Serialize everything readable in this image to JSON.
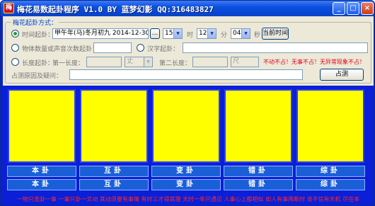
{
  "window": {
    "title": "梅花易数起卦程序 V1.0  BY 蓝梦幻影 QQ:316483827",
    "icon_char": "梅"
  },
  "titlebar_buttons": {
    "minimize": "_",
    "maximize": "□",
    "close": "×"
  },
  "group": {
    "title": "梅花起卦方式："
  },
  "time": {
    "label": "时间起卦：",
    "date_value": "甲午年(马)冬月初九 2014-12-30",
    "browse_label": "...",
    "hour_value": "15",
    "hour_unit": "时",
    "minute_value": "12",
    "minute_unit": "分",
    "second_value": "04",
    "second_unit": "秒",
    "now_button": "当前时间"
  },
  "quantity": {
    "label": "物体数量或声音次数起卦：",
    "value": "",
    "hanzi_label": "汉字起卦：",
    "hanzi_value": ""
  },
  "length": {
    "label": "长度起卦：",
    "first_label": "第一长度：",
    "first_value": "",
    "first_unit": "丈",
    "second_label": "第二长度：",
    "second_value": "",
    "second_unit": "尺",
    "note": "不动不占！无事不占！无异常现象不占！"
  },
  "question": {
    "label": "占测原因及疑问：",
    "value": "",
    "divine_button": "占测"
  },
  "hexagrams": {
    "labels": [
      "本卦",
      "互卦",
      "变卦",
      "错卦",
      "综卦"
    ],
    "labels_row2": [
      "本卦",
      "互卦",
      "变卦",
      "错卦",
      "综卦"
    ]
  },
  "footer": {
    "text": "一物只准卦一事  一事只卦一爻动  其动须要有事情  有时三才得其理  天时一年只遇见  人事心上都相似  如人有事再断时  谁不信有天机 尽在本"
  },
  "colors": {
    "window_bg": "#0a1fd6",
    "panel_fill": "#ffff00",
    "label_bg": "#1a5fd8",
    "accent_red": "#e0001b"
  }
}
